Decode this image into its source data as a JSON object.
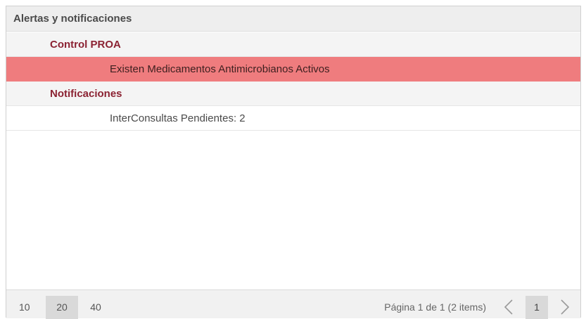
{
  "panel": {
    "title": "Alertas y notificaciones"
  },
  "groups": [
    {
      "label": "Control PROA",
      "items": [
        {
          "text": "Existen Medicamentos Antimicrobianos Activos",
          "highlight": true
        }
      ]
    },
    {
      "label": "Notificaciones",
      "items": [
        {
          "text": "InterConsultas Pendientes: 2",
          "highlight": false
        }
      ]
    }
  ],
  "pager": {
    "page_sizes": [
      "10",
      "20",
      "40"
    ],
    "selected_page_size": "20",
    "info": "Página 1 de 1 (2 items)",
    "current_page": "1",
    "prev_icon": "chevron-left-icon",
    "next_icon": "chevron-right-icon"
  },
  "colors": {
    "alert_row": "#ef7c7e",
    "group_label": "#8b2232"
  }
}
